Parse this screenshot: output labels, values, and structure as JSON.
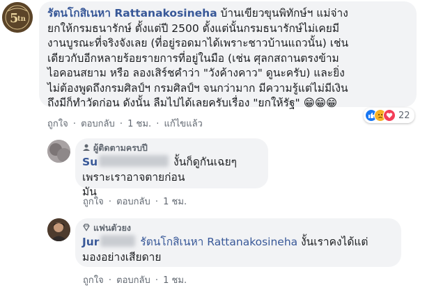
{
  "comment1": {
    "author": "รัตนโกสิเนหา Rattanakosineha",
    "lines": [
      "บ้านเขียวขุนพิทักษ์ฯ แม่จ่าง",
      "ยกให้กรมธนารักษ์ ตั้งแต่ปี 2500 ตั้งแต่นั้นกรมธนารักษ์ไม่เคยมี",
      "งานบูรณะที่จริงจังเลย (ที่อยู่รอดมาได้เพราะชาวบ้านแถวนั้น) เช่น",
      "เดียวกับอีกหลายร้อยรายการที่อยู่ในมือ (เช่น ศุลกสถานตรงข้าม",
      "ไอคอนสยาม หรือ ลองเสิร์ชคำว่า \"วังค้างคาว\" ดูนะครับ) และยิ่ง",
      "ไม่ต้องพูดถึงกรมศิลป์ฯ กรมศิลป์ฯ จนกว่ามาก มีความรู้แต่ไม่มีเงิน",
      "ถึงมีก็ทำวัดก่อน ดังนั้น ลืมไปได้เลยครับเรื่อง \"ยกให้รัฐ\""
    ],
    "trailing_emoji": "😁😁😁",
    "reaction_count": "22",
    "actions": {
      "like": "ถูกใจ",
      "reply": "ตอบกลับ",
      "time": "1 ชม.",
      "edited": "แก้ไขแล้ว",
      "sep": "·"
    }
  },
  "comment2": {
    "badge": "ผู้ติดตามครบปี",
    "author_prefix": "Su",
    "line1": "งั้นก็ดูกันเฉยๆ เพราะเราอาจตายก่อน",
    "line2": "มัน",
    "actions": {
      "like": "ถูกใจ",
      "reply": "ตอบกลับ",
      "time": "1 ชม.",
      "sep": "·"
    }
  },
  "comment3": {
    "badge": "แฟนตัวยง",
    "author_prefix": "Jur",
    "mention": "รัตนโกสิเนหา Rattanakosineha",
    "line1_rest": "งั้นเราคงได้แต่",
    "line2": "มองอย่างเสียดาย",
    "actions": {
      "like": "ถูกใจ",
      "reply": "ตอบกลับ",
      "time": "1 ชม.",
      "sep": "·"
    }
  },
  "colors": {
    "link": "#385898",
    "bubble": "#f2f3f5",
    "meta": "#606770",
    "like": "#1877f2",
    "love": "#f33e58",
    "haha": "#f7b125"
  }
}
